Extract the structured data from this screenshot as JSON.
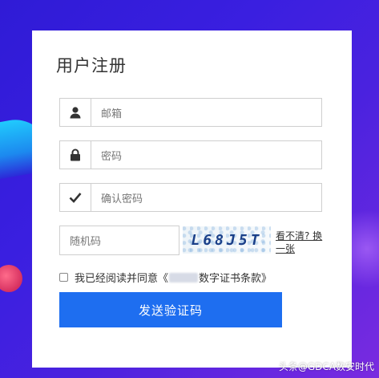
{
  "title": "用户注册",
  "fields": {
    "email": {
      "placeholder": "邮箱",
      "icon": "user-icon"
    },
    "password": {
      "placeholder": "密码",
      "icon": "lock-icon"
    },
    "confirm": {
      "placeholder": "确认密码",
      "icon": "check-icon"
    }
  },
  "captcha": {
    "placeholder": "随机码",
    "image_text": "L68J5T",
    "refresh_label": "看不清? 换一张"
  },
  "agreement": {
    "prefix": "我已经阅读并同意《",
    "suffix": "数字证书条款》"
  },
  "submit_label": "发送验证码",
  "watermark": "头条@GDCA数安时代",
  "colors": {
    "accent": "#1e6ef0",
    "background": "#3a1fe0"
  }
}
